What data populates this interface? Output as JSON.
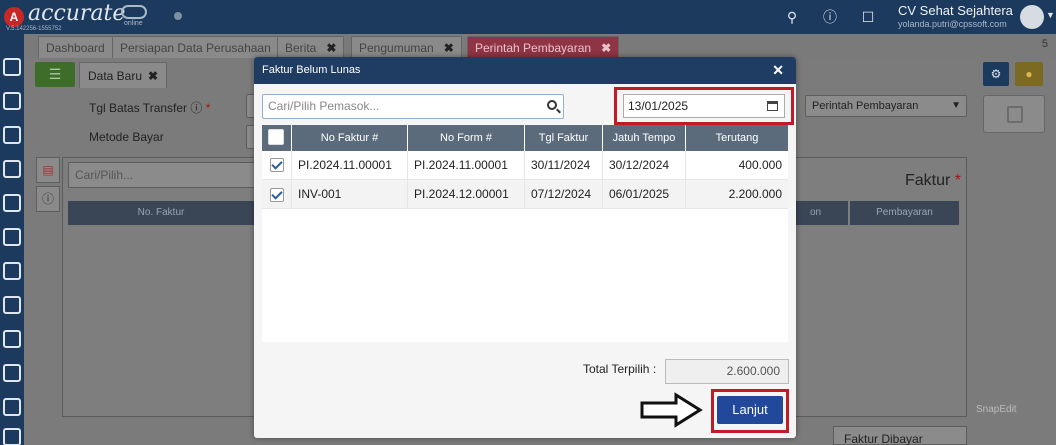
{
  "app": {
    "logo_text": "accurate",
    "logo_sub": "online",
    "version": "V.5.142256-1555752",
    "company": "CV Sehat Sejahtera",
    "email": "yolanda.putri@cpssoft.com"
  },
  "tabs": [
    {
      "label": "Dashboard"
    },
    {
      "label": "Persiapan Data Perusahaan"
    },
    {
      "label": "Berita"
    },
    {
      "label": "Pengumuman"
    },
    {
      "label": "Perintah Pembayaran"
    }
  ],
  "tab_count": "5",
  "form": {
    "subtab_label": "Data Baru",
    "tgl_batas_label": "Tgl Batas Transfer ⓘ",
    "metode_label": "Metode Bayar",
    "type_select": "Perintah Pembayaran",
    "search_placeholder": "Cari/Pilih...",
    "faktur_title": "Faktur",
    "bg_col_no_faktur": "No. Faktur",
    "bg_col_on": "on",
    "bg_col_pembayaran": "Pembayaran",
    "faktur_dibayar": "Faktur Dibayar",
    "watermark": "SnapEdit"
  },
  "modal": {
    "title": "Faktur Belum Lunas",
    "supplier_placeholder": "Cari/Pilih Pemasok...",
    "date": "13/01/2025",
    "columns": [
      "No Faktur #",
      "No Form #",
      "Tgl Faktur",
      "Jatuh Tempo",
      "Terutang"
    ],
    "rows": [
      {
        "checked": true,
        "no_faktur": "PI.2024.11.00001",
        "no_form": "PI.2024.11.00001",
        "tgl_faktur": "30/11/2024",
        "jatuh_tempo": "30/12/2024",
        "terutang": "400.000"
      },
      {
        "checked": true,
        "no_faktur": "INV-001",
        "no_form": "PI.2024.12.00001",
        "tgl_faktur": "07/12/2024",
        "jatuh_tempo": "06/01/2025",
        "terutang": "2.200.000"
      }
    ],
    "total_label": "Total Terpilih :",
    "total_value": "2.600.000",
    "next_label": "Lanjut"
  },
  "colors": {
    "header_navy": "#1f3d63",
    "highlight_red": "#c01c28",
    "button_blue": "#21489a",
    "active_tab": "#8e3444"
  }
}
